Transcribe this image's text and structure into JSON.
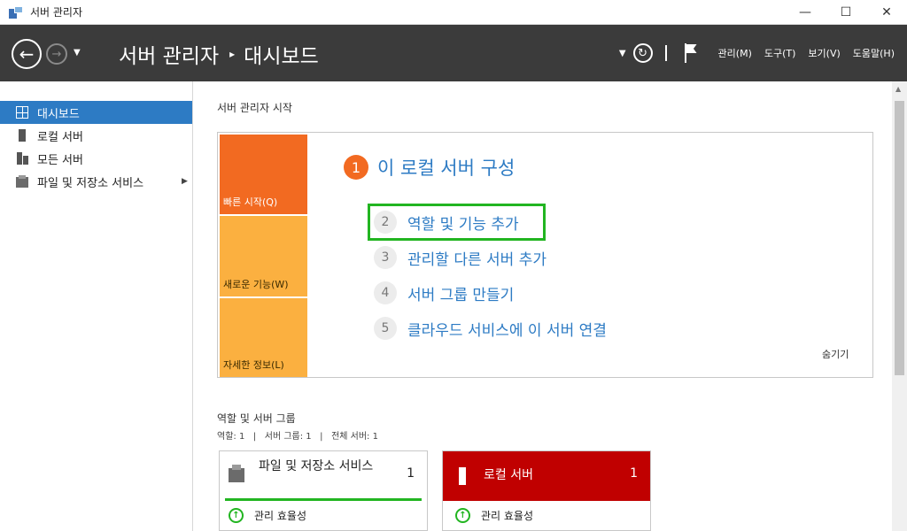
{
  "window": {
    "title": "서버 관리자",
    "controls": {
      "minimize": "—",
      "maximize": "☐",
      "close": "✕"
    }
  },
  "header": {
    "breadcrumb_root": "서버 관리자",
    "breadcrumb_sep": "▸",
    "breadcrumb_current": "대시보드",
    "menu": {
      "manage": "관리(M)",
      "tools": "도구(T)",
      "view": "보기(V)",
      "help": "도움말(H)"
    },
    "icons": {
      "back": "back-arrow-icon",
      "forward": "forward-arrow-icon",
      "refresh": "refresh-icon",
      "flag": "notification-flag-icon"
    }
  },
  "sidebar": {
    "items": [
      {
        "label": "대시보드",
        "icon": "dashboard-icon",
        "active": true
      },
      {
        "label": "로컬 서버",
        "icon": "server-icon"
      },
      {
        "label": "모든 서버",
        "icon": "servers-icon"
      },
      {
        "label": "파일 및 저장소 서비스",
        "icon": "file-storage-icon"
      }
    ]
  },
  "main": {
    "welcome_title": "서버 관리자 시작",
    "quickstart": {
      "tabs": [
        "빠른 시작(Q)",
        "새로운 기능(W)",
        "자세한 정보(L)"
      ],
      "step1": {
        "num": "1",
        "text": "이 로컬 서버 구성"
      },
      "steps": [
        {
          "num": "2",
          "text": "역할 및 기능 추가"
        },
        {
          "num": "3",
          "text": "관리할 다른 서버 추가"
        },
        {
          "num": "4",
          "text": "서버 그룹 만들기"
        },
        {
          "num": "5",
          "text": "클라우드 서비스에 이 서버 연결"
        }
      ],
      "hide": "숨기기"
    },
    "roles": {
      "title": "역할 및 서버 그룹",
      "summary": "역할: 1   |   서버 그룹: 1   |   전체 서버: 1",
      "tiles": [
        {
          "name": "파일 및 저장소 서비스",
          "count": "1",
          "status": "관리 효율성",
          "header_color": "#ffffff"
        },
        {
          "name": "로컬 서버",
          "count": "1",
          "status": "관리 효율성",
          "header_color": "#c00000"
        }
      ]
    }
  },
  "colors": {
    "accent_blue": "#2d7bc4",
    "quickstart_orange": "#f26a21",
    "tab_amber": "#fbb040",
    "highlight_green": "#22b521",
    "alert_red": "#c00000",
    "header_dark": "#3b3b3b"
  }
}
